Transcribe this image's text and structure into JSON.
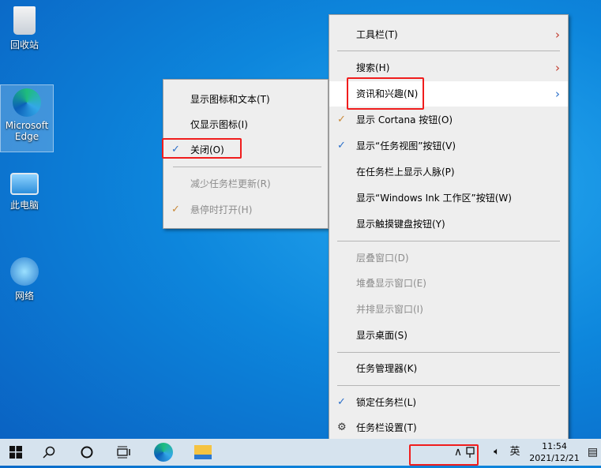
{
  "desktop": {
    "icons": [
      {
        "label": "回收站"
      },
      {
        "label": "Microsoft Edge"
      },
      {
        "label": "此电脑"
      },
      {
        "label": "网络"
      }
    ]
  },
  "context_menu": {
    "items": [
      {
        "label": "工具栏(T)",
        "submenu": true
      },
      {
        "label": "搜索(H)",
        "submenu": true
      },
      {
        "label": "资讯和兴趣(N)",
        "submenu": true,
        "highlighted": true
      },
      {
        "label": "显示 Cortana 按钮(O)",
        "checked": true
      },
      {
        "label": "显示“任务视图”按钮(V)",
        "checked": true
      },
      {
        "label": "在任务栏上显示人脉(P)"
      },
      {
        "label": "显示“Windows Ink 工作区”按钮(W)"
      },
      {
        "label": "显示触摸键盘按钮(Y)"
      },
      {
        "label": "层叠窗口(D)",
        "disabled": true
      },
      {
        "label": "堆叠显示窗口(E)",
        "disabled": true
      },
      {
        "label": "并排显示窗口(I)",
        "disabled": true
      },
      {
        "label": "显示桌面(S)"
      },
      {
        "label": "任务管理器(K)"
      },
      {
        "label": "锁定任务栏(L)",
        "checked": true
      },
      {
        "label": "任务栏设置(T)",
        "icon": "gear-icon"
      }
    ]
  },
  "submenu": {
    "items": [
      {
        "label": "显示图标和文本(T)"
      },
      {
        "label": "仅显示图标(I)"
      },
      {
        "label": "关闭(O)",
        "checked": true
      },
      {
        "label": "减少任务栏更新(R)",
        "disabled": true
      },
      {
        "label": "悬停时打开(H)",
        "disabled": true,
        "checked": true
      }
    ]
  },
  "taskbar": {
    "ime": "英",
    "time": "11:54",
    "date": "2021/12/21"
  },
  "glyphs": {
    "check": "✓",
    "chevron": "›",
    "gear": "⚙"
  }
}
